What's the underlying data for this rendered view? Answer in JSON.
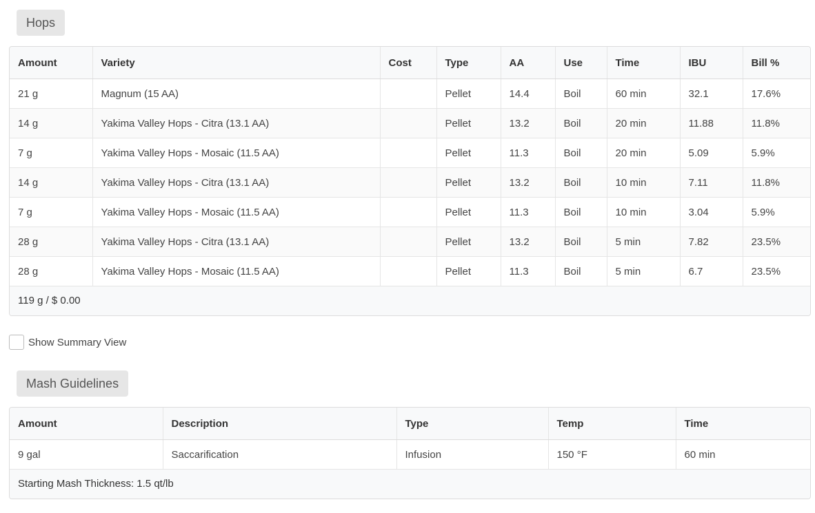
{
  "hops": {
    "section_title": "Hops",
    "columns": [
      "Amount",
      "Variety",
      "Cost",
      "Type",
      "AA",
      "Use",
      "Time",
      "IBU",
      "Bill %"
    ],
    "rows": [
      [
        "21 g",
        "Magnum (15 AA)",
        "",
        "Pellet",
        "14.4",
        "Boil",
        "60 min",
        "32.1",
        "17.6%"
      ],
      [
        "14 g",
        "Yakima Valley Hops - Citra (13.1 AA)",
        "",
        "Pellet",
        "13.2",
        "Boil",
        "20 min",
        "11.88",
        "11.8%"
      ],
      [
        "7 g",
        "Yakima Valley Hops - Mosaic (11.5 AA)",
        "",
        "Pellet",
        "11.3",
        "Boil",
        "20 min",
        "5.09",
        "5.9%"
      ],
      [
        "14 g",
        "Yakima Valley Hops - Citra (13.1 AA)",
        "",
        "Pellet",
        "13.2",
        "Boil",
        "10 min",
        "7.11",
        "11.8%"
      ],
      [
        "7 g",
        "Yakima Valley Hops - Mosaic (11.5 AA)",
        "",
        "Pellet",
        "11.3",
        "Boil",
        "10 min",
        "3.04",
        "5.9%"
      ],
      [
        "28 g",
        "Yakima Valley Hops - Citra (13.1 AA)",
        "",
        "Pellet",
        "13.2",
        "Boil",
        "5 min",
        "7.82",
        "23.5%"
      ],
      [
        "28 g",
        "Yakima Valley Hops - Mosaic (11.5 AA)",
        "",
        "Pellet",
        "11.3",
        "Boil",
        "5 min",
        "6.7",
        "23.5%"
      ]
    ],
    "footer": "119 g / $ 0.00"
  },
  "summary_toggle": {
    "label": "Show Summary View",
    "checked": false
  },
  "mash": {
    "section_title": "Mash Guidelines",
    "columns": [
      "Amount",
      "Description",
      "Type",
      "Temp",
      "Time"
    ],
    "rows": [
      [
        "9 gal",
        "Saccarification",
        "Infusion",
        "150 °F",
        "60 min"
      ]
    ],
    "footer": "Starting Mash Thickness: 1.5 qt/lb"
  }
}
